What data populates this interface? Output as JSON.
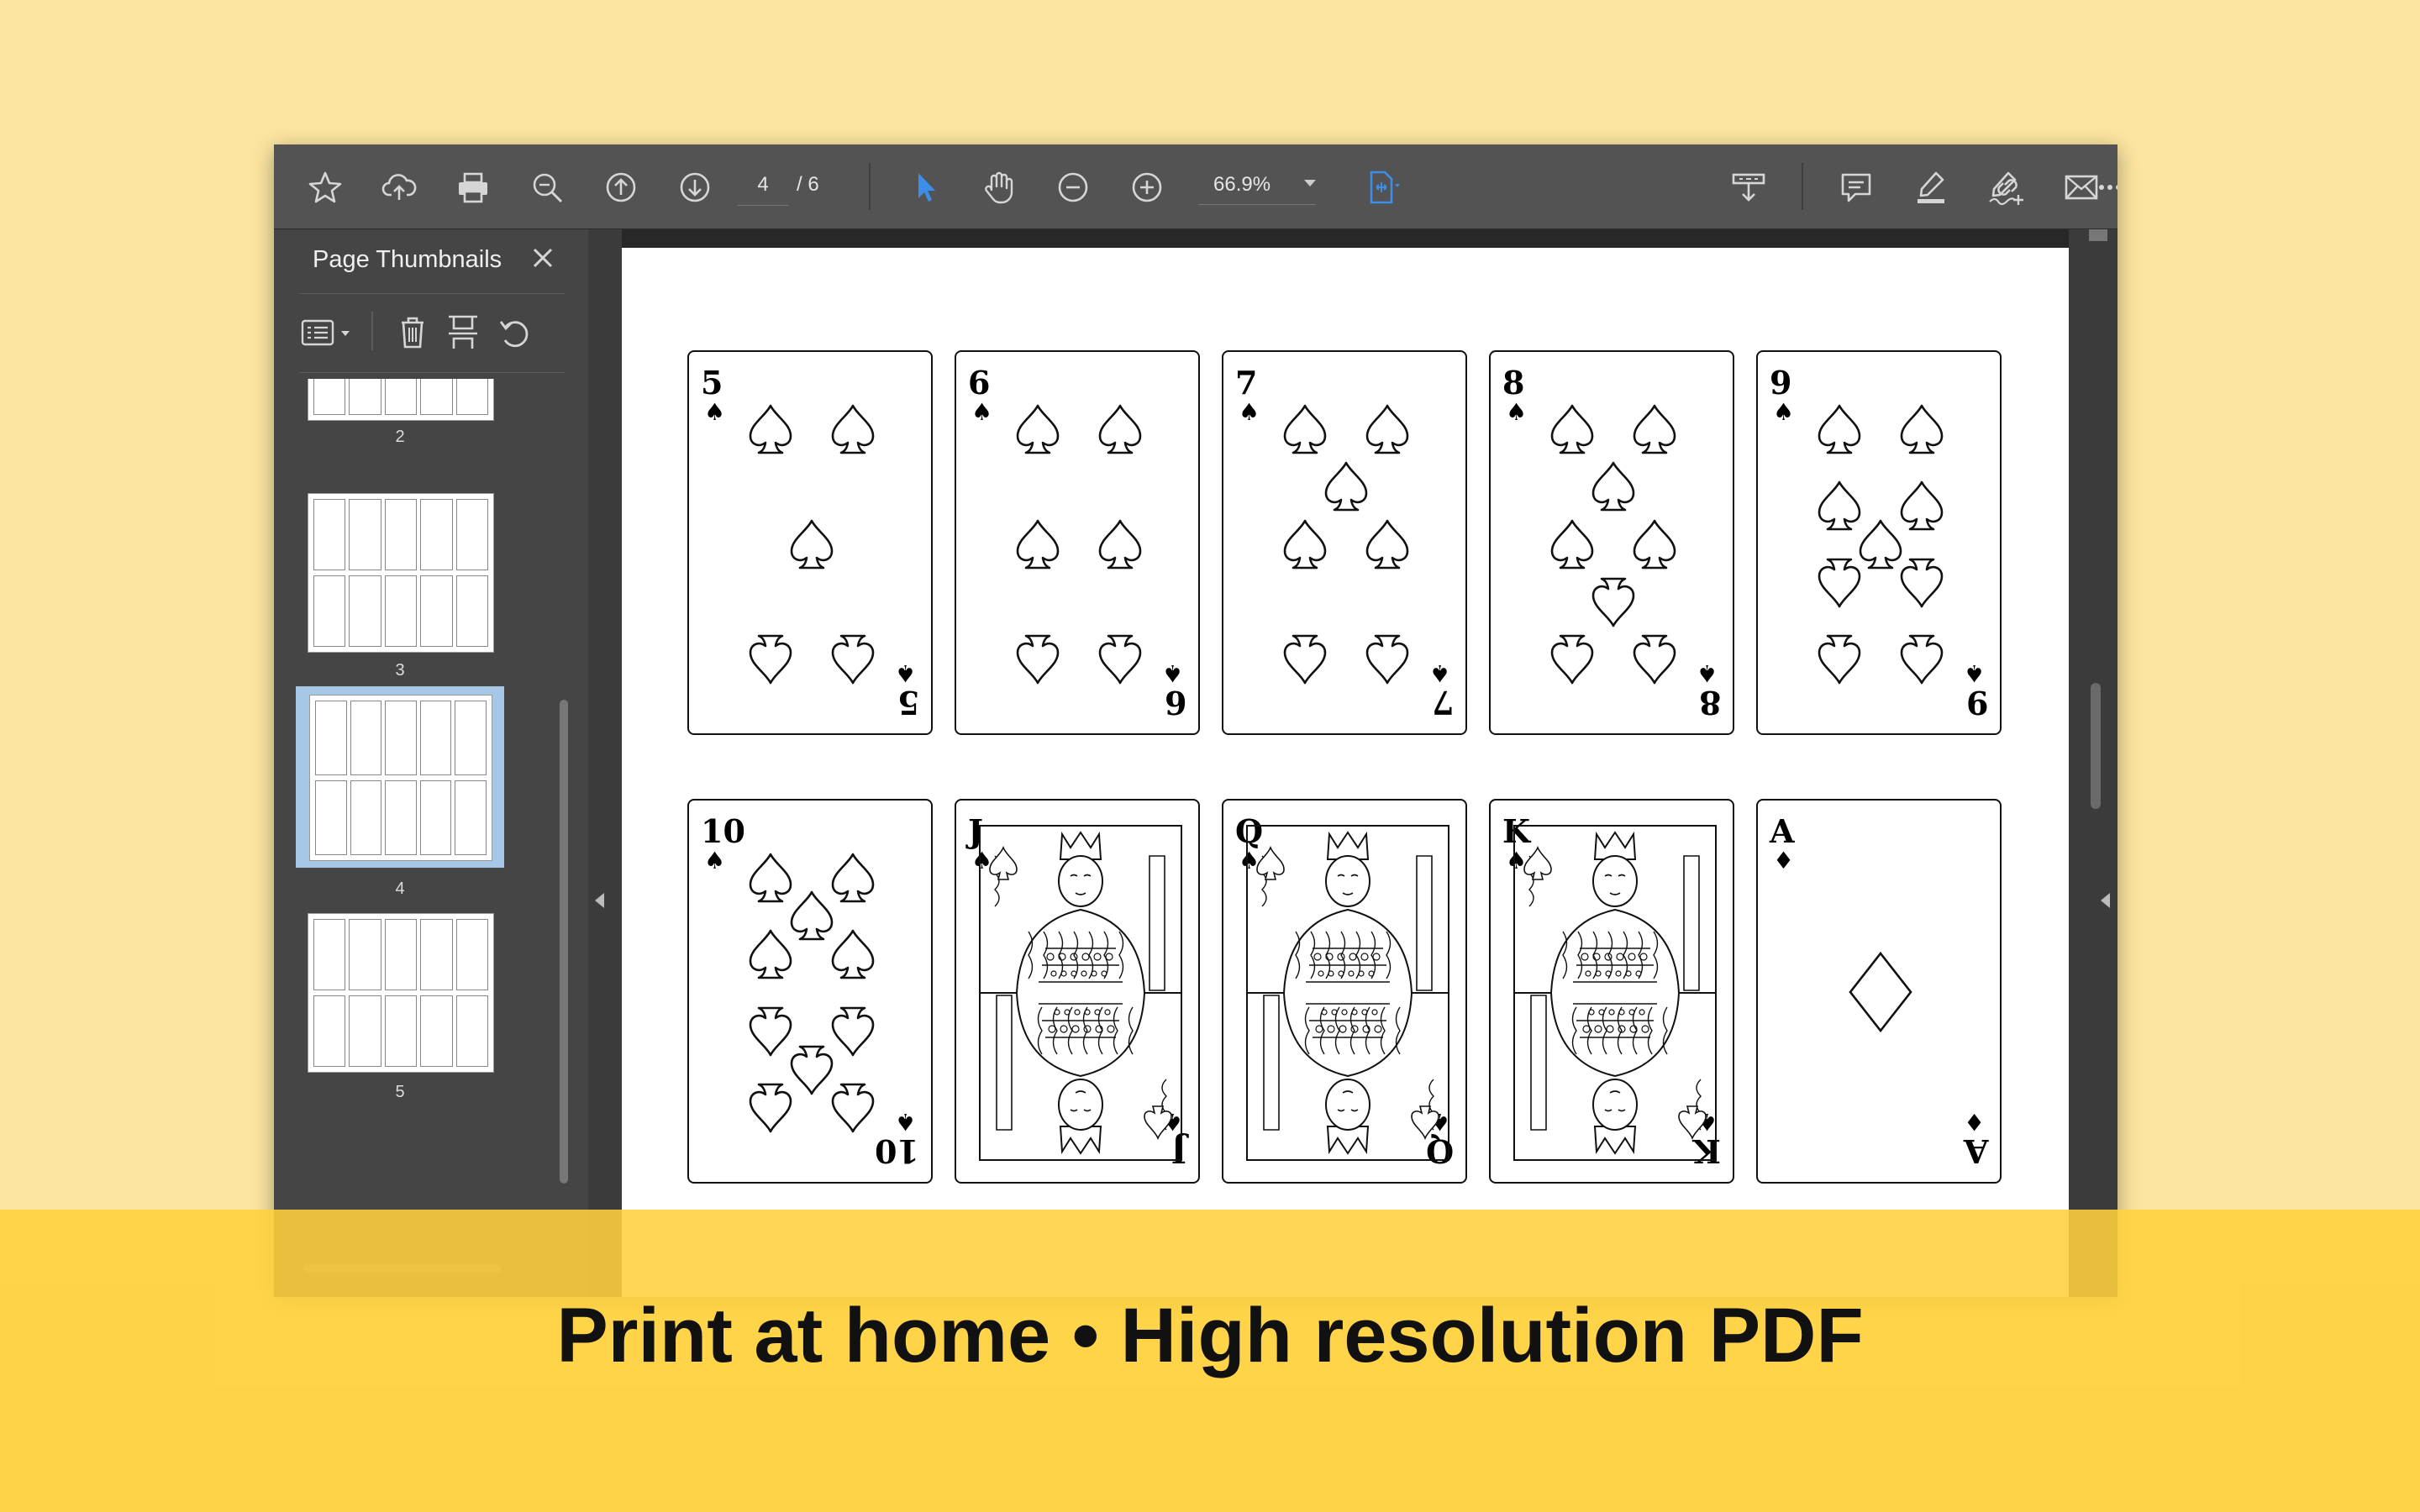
{
  "toolbar": {
    "page_current": "4",
    "page_total": "/ 6",
    "zoom": "66.9%",
    "icons": [
      "star-icon",
      "cloud-upload-icon",
      "print-icon",
      "zoom-search-icon",
      "page-up-icon",
      "page-down-icon",
      "select-arrow-icon",
      "hand-icon",
      "zoom-out-icon",
      "zoom-in-icon",
      "fit-page-icon",
      "scroll-mode-icon",
      "comment-icon",
      "highlight-icon",
      "sign-icon",
      "more-icon",
      "share-link-icon",
      "email-icon"
    ]
  },
  "sidebar": {
    "title": "Page Thumbnails",
    "thumbnails": [
      {
        "num": "2"
      },
      {
        "num": "3"
      },
      {
        "num": "4",
        "selected": true
      },
      {
        "num": "5"
      }
    ]
  },
  "cards": [
    {
      "rank": "5",
      "suit": "♠",
      "type": "pips"
    },
    {
      "rank": "6",
      "suit": "♠",
      "type": "pips"
    },
    {
      "rank": "7",
      "suit": "♠",
      "type": "pips"
    },
    {
      "rank": "8",
      "suit": "♠",
      "type": "pips"
    },
    {
      "rank": "9",
      "suit": "♠",
      "type": "pips"
    },
    {
      "rank": "10",
      "suit": "♠",
      "type": "pips"
    },
    {
      "rank": "J",
      "suit": "♠",
      "type": "face"
    },
    {
      "rank": "Q",
      "suit": "♠",
      "type": "face"
    },
    {
      "rank": "K",
      "suit": "♠",
      "type": "face"
    },
    {
      "rank": "A",
      "suit": "♦",
      "type": "ace"
    }
  ],
  "caption": "Print at home • High resolution PDF",
  "colors": {
    "accent": "#3d8ee8",
    "banner": "#ffd13c",
    "background": "#fbe5a0"
  }
}
